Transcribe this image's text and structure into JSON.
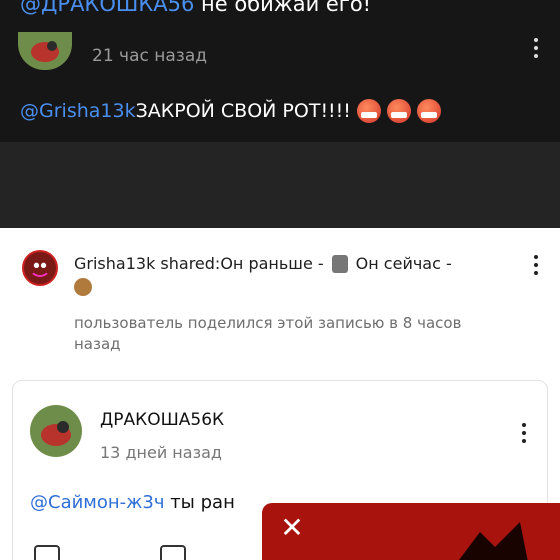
{
  "top_comment": {
    "mention": "@ДРАКОШКА56",
    "text": " не обижай его!"
  },
  "reply": {
    "time": "21 час назад",
    "mention": "@Grisha13k",
    "text": " ЗАКРОЙ СВОЙ РОТ!!!!"
  },
  "shared": {
    "user_prefix": "Grisha13k shared:",
    "before_text": " Он раньше -",
    "now_text": "Он сейчас -",
    "meta": "пользователь поделился этой записью в 8 часов назад"
  },
  "card": {
    "username": "ДРАКОША56К",
    "time": "13 дней назад",
    "mention": "@Саймон-ж3ч",
    "text": " ты ран"
  },
  "overlay": {
    "close_label": "✕"
  },
  "colors": {
    "mention_dark": "#4a8ff0",
    "mention_light": "#2f6fd8",
    "overlay": "#a8140d"
  }
}
